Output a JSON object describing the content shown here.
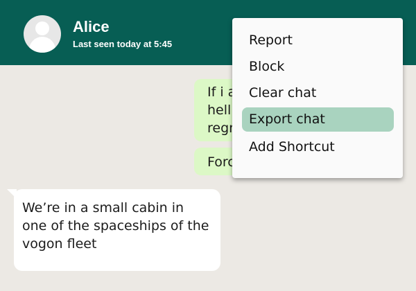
{
  "header": {
    "name": "Alice",
    "status": "Last seen today at 5:45",
    "avatar_icon": "default-person-avatar"
  },
  "messages": [
    {
      "direction": "outgoing",
      "text": "If i a\nhell\nregr"
    },
    {
      "direction": "outgoing",
      "text": "Forc"
    },
    {
      "direction": "incoming",
      "text": "We’re in a small cabin in one of the spaceships of the vogon fleet"
    }
  ],
  "menu": {
    "items": [
      {
        "label": "Report"
      },
      {
        "label": "Block"
      },
      {
        "label": "Clear chat"
      },
      {
        "label": "Export chat",
        "highlighted": true
      },
      {
        "label": "Add Shortcut"
      }
    ]
  },
  "colors": {
    "header": "#075e54",
    "chat_background": "#ece9e4",
    "outgoing_bubble": "#dcf8c6",
    "incoming_bubble": "#ffffff",
    "menu_highlight": "#a9d3bf"
  }
}
